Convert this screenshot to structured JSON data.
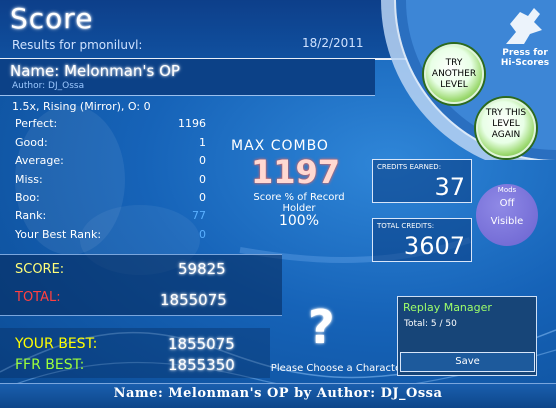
{
  "header": {
    "title": "Score",
    "results_for": "Results for pmoniluvl:",
    "date": "18/2/2011"
  },
  "song": {
    "name": "Name: Melonman's OP",
    "author": "Author: DJ_Ossa",
    "mods_line": "1.5x, Rising (Mirror), O: 0"
  },
  "stats": [
    {
      "label": "Perfect:",
      "value": "1196"
    },
    {
      "label": "Good:",
      "value": "1"
    },
    {
      "label": "Average:",
      "value": "0"
    },
    {
      "label": "Miss:",
      "value": "0"
    },
    {
      "label": "Boo:",
      "value": "0"
    },
    {
      "label": "Rank:",
      "value": "77"
    },
    {
      "label": "Your Best Rank:",
      "value": "0"
    }
  ],
  "combo": {
    "label": "MAX COMBO",
    "value": "1197",
    "pct_label": "Score % of Record Holder",
    "pct_value": "100%"
  },
  "credits": {
    "earned_label": "CREDITS EARNED:",
    "earned_value": "37",
    "total_label": "TOTAL CREDITS:",
    "total_value": "3607"
  },
  "mods_bubble": {
    "title": "Mods",
    "line1": "Off",
    "line2": "Visible"
  },
  "score": {
    "score_label": "SCORE:",
    "score_value": "59825",
    "total_label": "TOTAL:",
    "total_value": "1855075",
    "your_best_label": "YOUR BEST:",
    "your_best_value": "1855075",
    "ffr_best_label": "FFR BEST:",
    "ffr_best_value": "1855350"
  },
  "character": {
    "glyph": "?",
    "prompt": "Please Choose a Character"
  },
  "replay": {
    "title": "Replay Manager",
    "total": "Total: 5 / 50",
    "save_label": "Save"
  },
  "buttons": {
    "try_another": "TRY ANOTHER LEVEL",
    "try_level": "TRY THIS LEVEL AGAIN",
    "hiscores": "Press for Hi-Scores"
  },
  "footer": {
    "text": "Name:  Melonman's  OP  by  Author:  DJ_Ossa"
  },
  "colors": {
    "background": "#1663b8",
    "score_label": "#ffff7a",
    "total_label": "#ff4040",
    "your_best_label": "#ffff00",
    "ffr_best_label": "#9dff3a",
    "rank_value": "#5ab0ff",
    "replay_title": "#9dff6a"
  }
}
